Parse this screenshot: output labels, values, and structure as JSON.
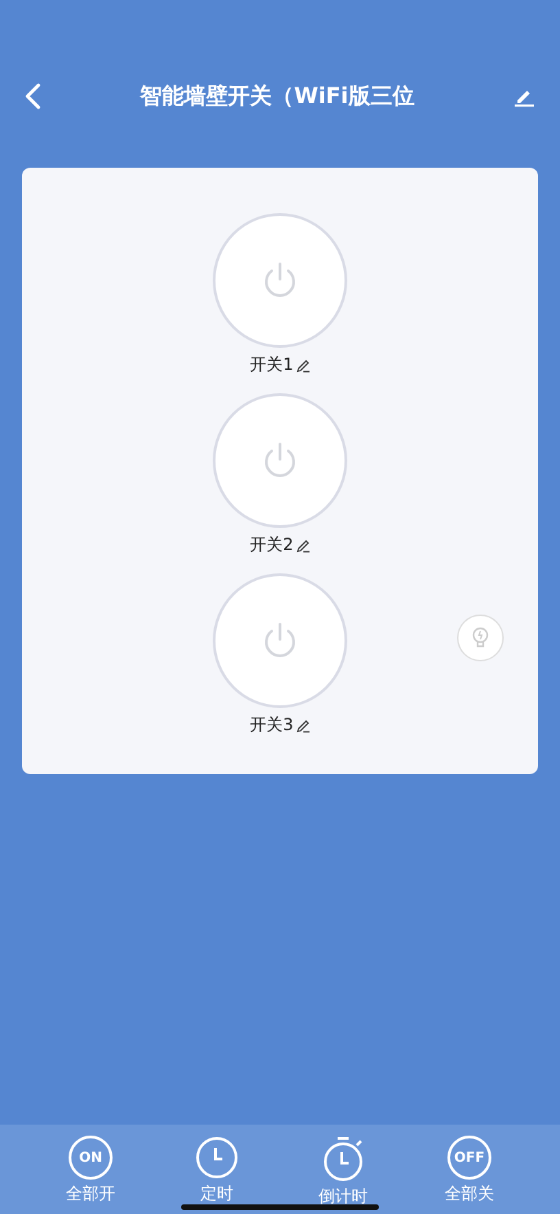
{
  "header": {
    "title": "智能墙壁开关（WiFi版三位"
  },
  "switches": [
    {
      "label": "开关1",
      "on": false
    },
    {
      "label": "开关2",
      "on": false
    },
    {
      "label": "开关3",
      "on": false
    }
  ],
  "bottom_bar": [
    {
      "kind": "badge",
      "badge": "ON",
      "label": "全部开"
    },
    {
      "kind": "clock",
      "label": "定时"
    },
    {
      "kind": "timer",
      "label": "倒计时"
    },
    {
      "kind": "badge",
      "badge": "OFF",
      "label": "全部关"
    }
  ]
}
